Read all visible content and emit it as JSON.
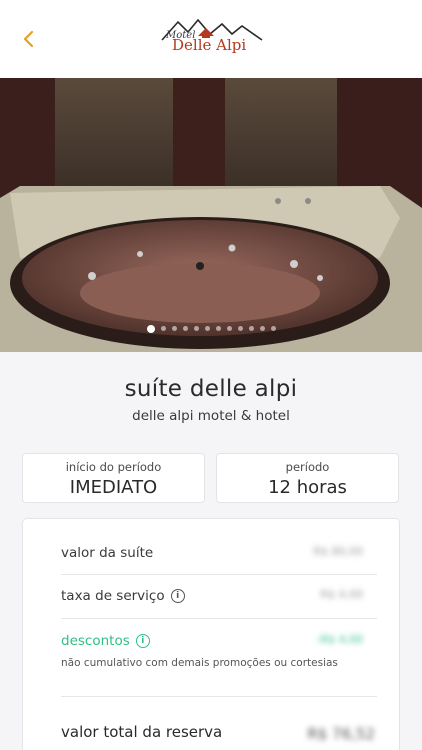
{
  "header": {
    "back_icon": "chevron-left-icon",
    "logo": {
      "small_text": "Motel",
      "main_text": "Delle Alpi"
    }
  },
  "colors": {
    "accent": "#e2a12a",
    "logo_red": "#b23a1e",
    "discount": "#2fbf86"
  },
  "gallery": {
    "image_count": 12,
    "active_index": 0
  },
  "suite": {
    "title": "suíte  delle alpi",
    "subtitle": "delle alpi motel & hotel"
  },
  "period_start": {
    "label": "início do período",
    "value": "IMEDIATO"
  },
  "period": {
    "label": "período",
    "value": "12 horas"
  },
  "pricing": {
    "suite_value_label": "valor da suíte",
    "suite_value": "R$ 80,00",
    "service_fee_label": "taxa de serviço",
    "service_fee": "R$ 4,00",
    "discounts_label": "descontos",
    "discounts": "-R$ 4,00",
    "discounts_note": "não cumulativo com demais promoções ou cortesias",
    "total_label": "valor total da reserva",
    "total": "R$ 76,52"
  }
}
